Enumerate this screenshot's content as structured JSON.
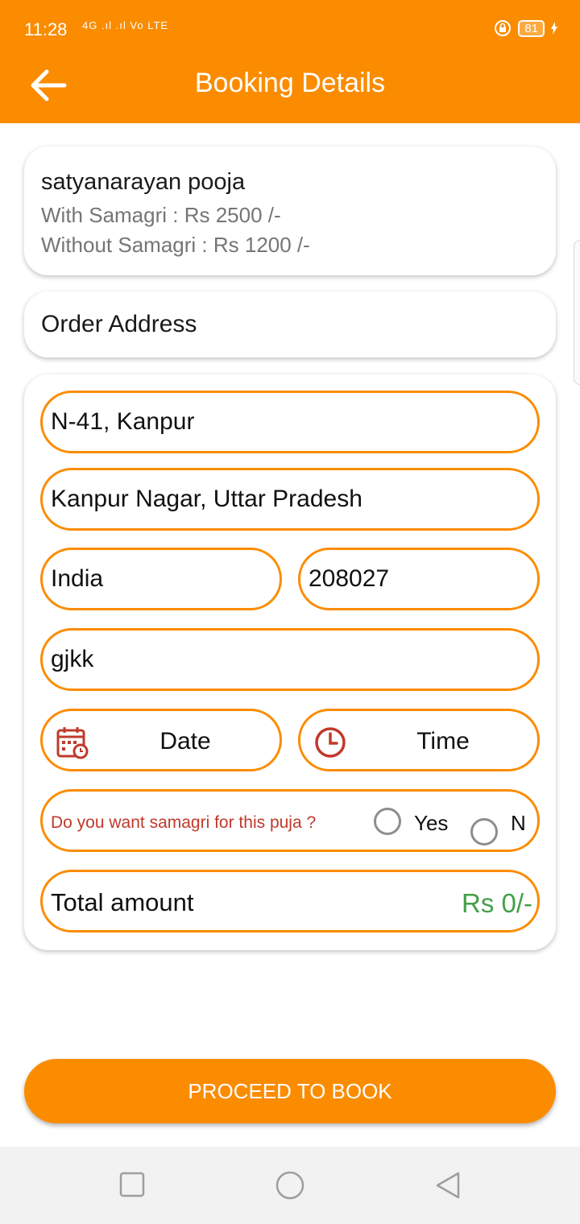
{
  "status": {
    "time": "11:28",
    "network": "4G .ıl .ıl Vo LTE",
    "battery": "81"
  },
  "header": {
    "title": "Booking Details",
    "back_icon": "arrow-left-icon"
  },
  "service": {
    "name": "satyanarayan pooja",
    "with_samagri": "With Samagri : Rs 2500 /-",
    "without_samagri": "Without Samagri : Rs 1200 /-"
  },
  "address_section": {
    "title": "Order Address"
  },
  "form": {
    "address_line1": "N-41, Kanpur",
    "address_line2": "Kanpur Nagar, Uttar Pradesh",
    "country": "India",
    "pincode": "208027",
    "landmark": "gjkk",
    "date_label": "Date",
    "time_label": "Time",
    "samagri_question": "Do you want samagri for this puja ?",
    "option_yes": "Yes",
    "option_no": "N",
    "total_label": "Total amount",
    "total_value": "Rs 0/-"
  },
  "actions": {
    "proceed_label": "PROCEED TO BOOK"
  },
  "colors": {
    "accent": "#fb8c00",
    "amount": "#43a047",
    "question": "#c0392b"
  }
}
